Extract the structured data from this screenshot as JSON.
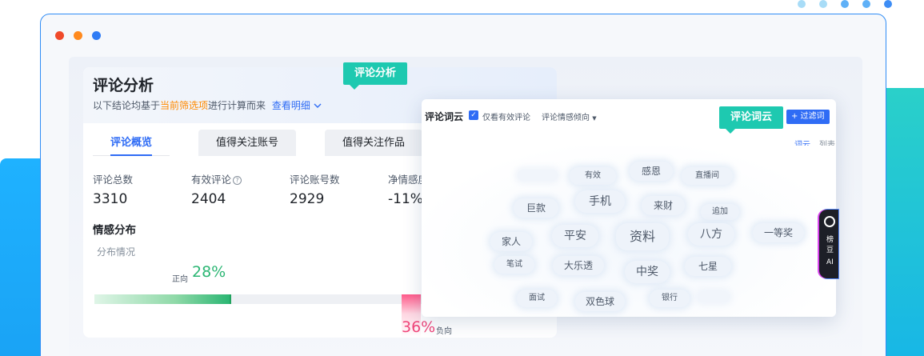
{
  "window": {
    "controls": [
      "close",
      "minimize",
      "maximize"
    ]
  },
  "analysis": {
    "title": "评论分析",
    "subtitle_prefix": "以下结论均基于",
    "subtitle_highlight": "当前筛选项",
    "subtitle_suffix": "进行计算而来",
    "detail_link": "查看明细",
    "tabs": [
      "评论概览",
      "值得关注账号",
      "值得关注作品"
    ],
    "active_tab": "评论概览",
    "metrics": [
      {
        "label": "评论总数",
        "value": "3310"
      },
      {
        "label": "有效评论",
        "value": "2404",
        "help": "?"
      },
      {
        "label": "评论账号数",
        "value": "2929"
      },
      {
        "label": "净情感度",
        "value": "-11%",
        "help": "?"
      }
    ],
    "sentiment": {
      "section_title": "情感分布",
      "subtitle": "分布情况",
      "positive_label": "正向",
      "positive_value": "28%",
      "positive_fraction": 0.28,
      "negative_label": "负向",
      "negative_value": "36%",
      "negative_fraction": 0.36
    }
  },
  "tags": {
    "analysis": "评论分析",
    "wordcloud": "评论词云"
  },
  "wordcloud": {
    "title": "评论词云",
    "checkbox_label": "仅看有效评论",
    "checkbox_checked": true,
    "sentiment_dropdown": "评论情感倾向",
    "filter_button": "+ 过滤词",
    "views": [
      "词云",
      "列表"
    ],
    "active_view": "词云",
    "words": [
      "有效",
      "感恩",
      "直播间",
      "巨款",
      "手机",
      "来财",
      "追加",
      "家人",
      "平安",
      "资料",
      "八方",
      "一等奖",
      "笔试",
      "大乐透",
      "中奖",
      "七星",
      "面试",
      "双色球",
      "银行"
    ]
  },
  "ai_widget": {
    "chars": [
      "榜",
      "豆",
      "AI"
    ]
  },
  "colors": {
    "accent": "#2f6cf5",
    "positive": "#2bb673",
    "negative": "#f0467a",
    "tag": "#1ec9b0",
    "highlight": "#ff8a00"
  }
}
